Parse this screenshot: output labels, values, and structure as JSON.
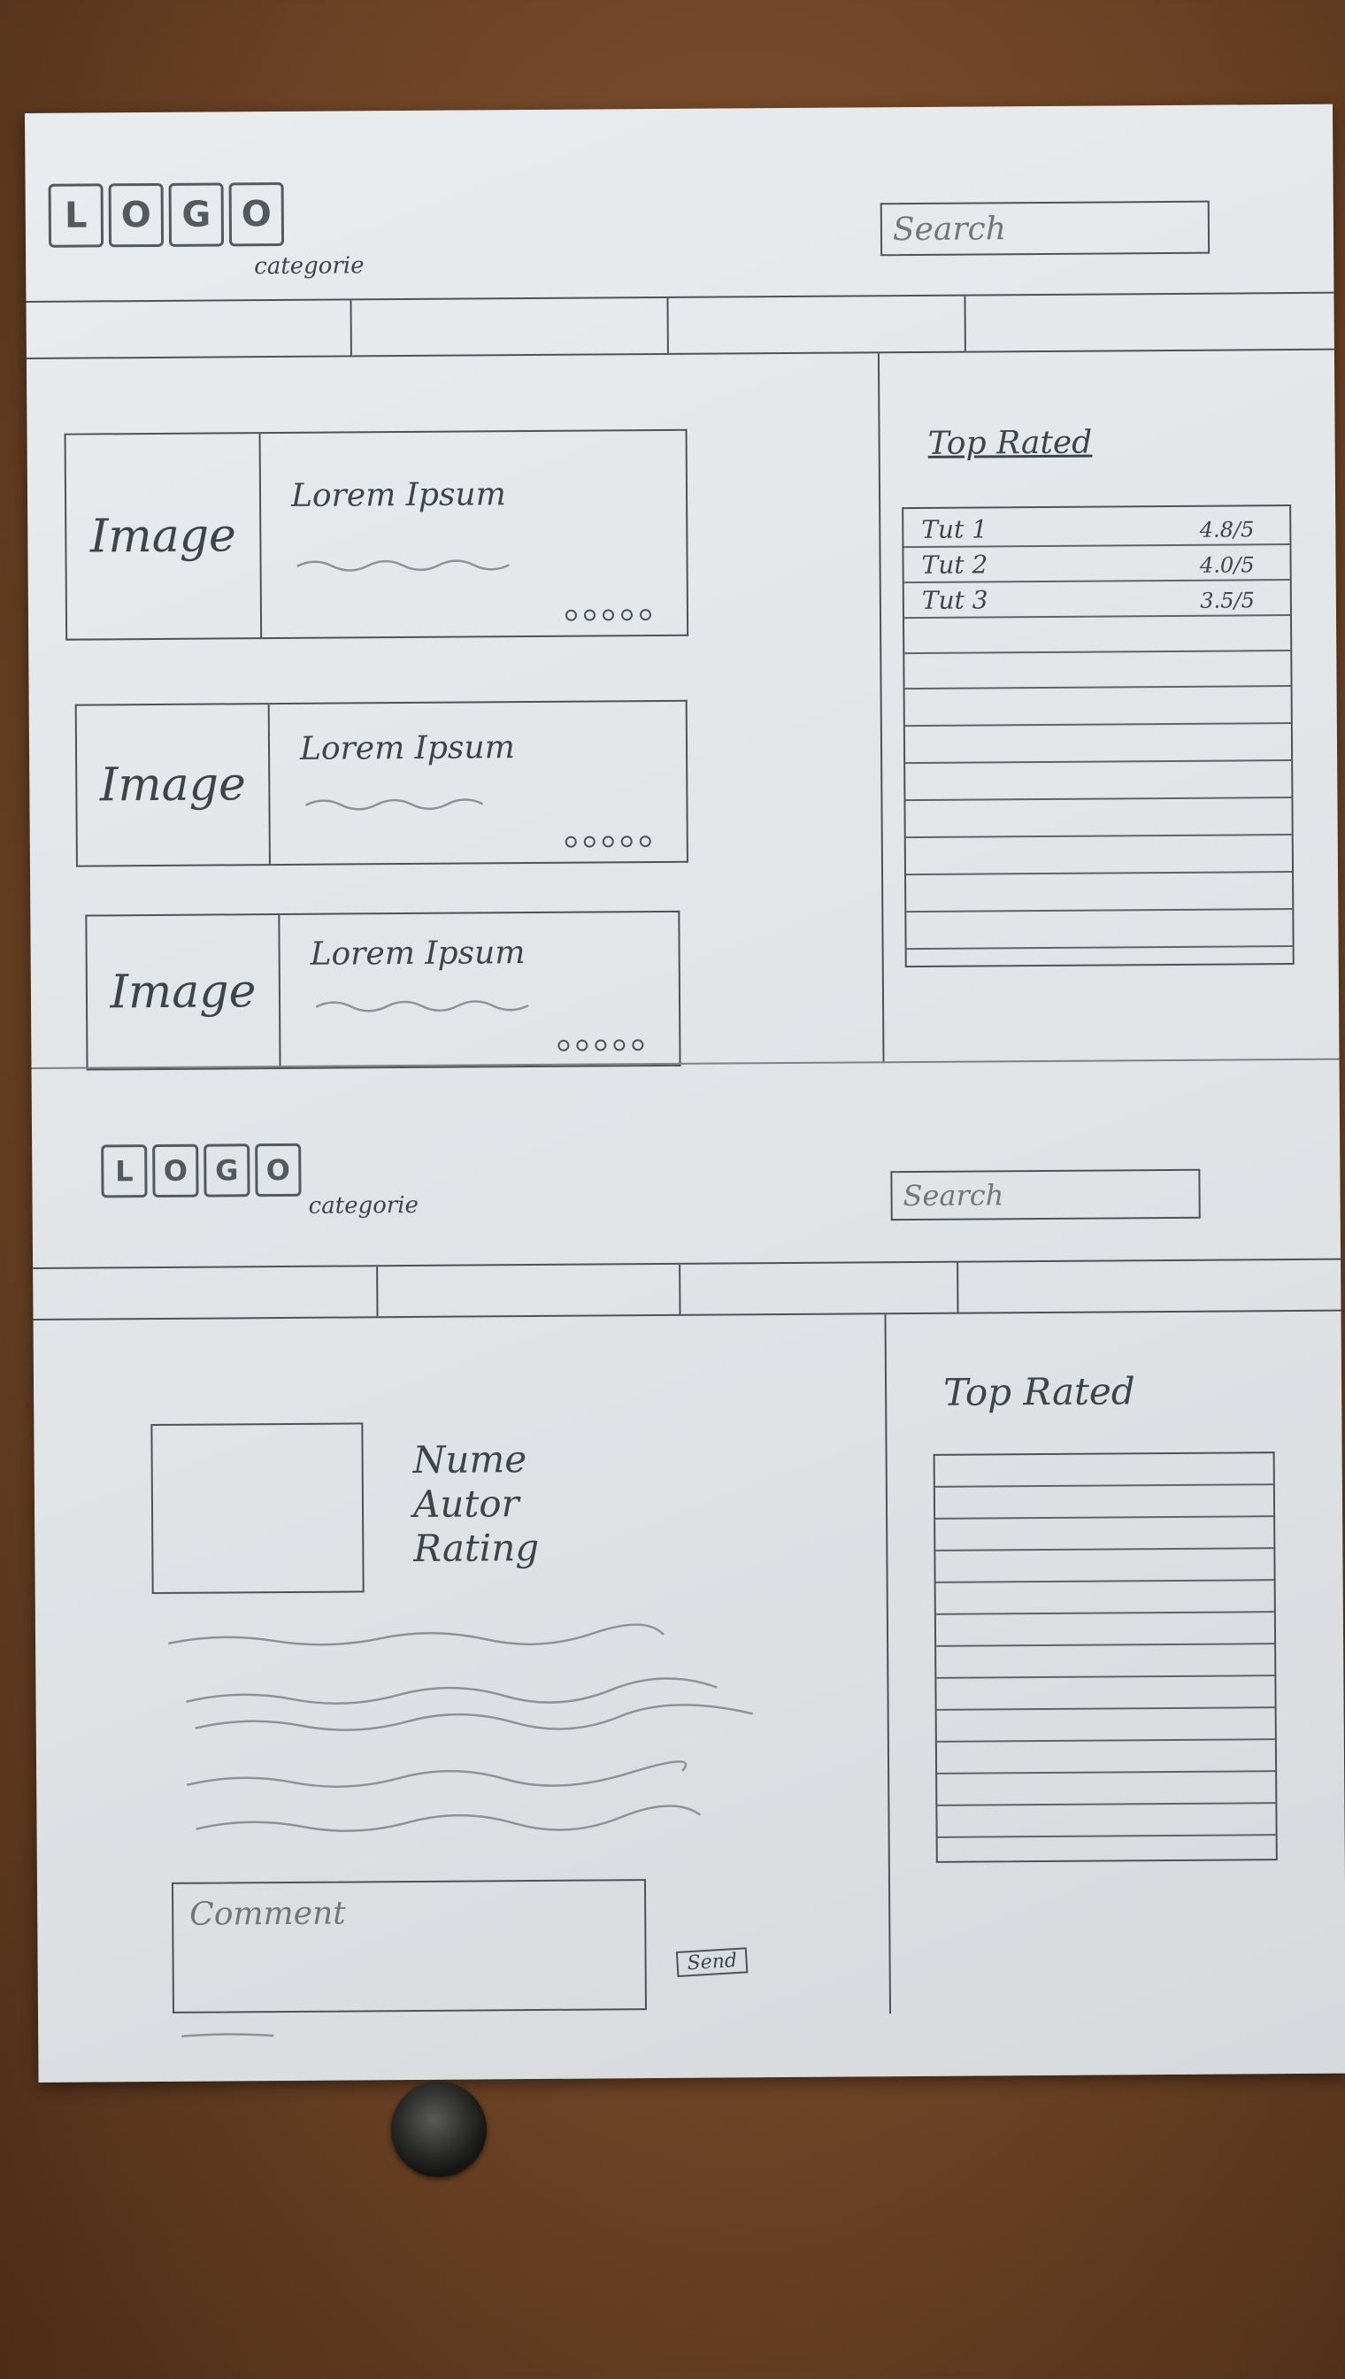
{
  "wireframe1": {
    "logo": [
      "L",
      "O",
      "G",
      "O"
    ],
    "category": "categorie",
    "search_placeholder": "Search",
    "nav_items": [
      "",
      "",
      "",
      ""
    ],
    "cards": [
      {
        "image_label": "Image",
        "title": "Lorem Ipsum"
      },
      {
        "image_label": "Image",
        "title": "Lorem Ipsum"
      },
      {
        "image_label": "Image",
        "title": "Lorem Ipsum"
      }
    ],
    "top_rated": {
      "title": "Top Rated",
      "rows": [
        {
          "name": "Tut 1",
          "rating": "4.8/5"
        },
        {
          "name": "Tut 2",
          "rating": "4.0/5"
        },
        {
          "name": "Tut 3",
          "rating": "3.5/5"
        }
      ]
    }
  },
  "wireframe2": {
    "logo": [
      "L",
      "O",
      "G",
      "O"
    ],
    "category": "categorie",
    "search_placeholder": "Search",
    "nav_items": [
      "",
      "",
      "",
      ""
    ],
    "detail": {
      "name": "Nume",
      "author": "Autor",
      "rating": "Rating"
    },
    "comment_placeholder": "Comment",
    "send_label": "Send",
    "top_rated": {
      "title": "Top Rated"
    }
  },
  "colors": {
    "pencil": "#4d5257",
    "paper": "#e2e6e9",
    "table": "#6e4426"
  }
}
